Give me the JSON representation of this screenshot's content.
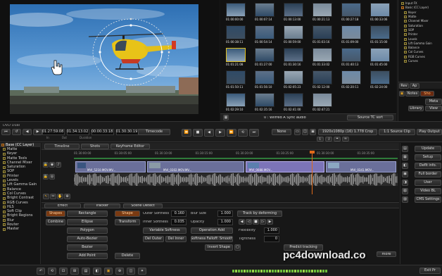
{
  "viewer": {
    "title": "DVD Dual"
  },
  "clip_grid": {
    "timecodes": [
      "01:00:00:00",
      "01:00:07:14",
      "01:00:13:00",
      "01:00:21:13",
      "01:00:27:18",
      "01:00:33:06",
      "01:00:38:11",
      "01:00:54:14",
      "01:00:59:00",
      "01:01:03:16",
      "01:01:09:00",
      "01:01:15:00",
      "01:01:21:08",
      "01:01:27:00",
      "01:01:30:16",
      "01:01:33:02",
      "01:01:40:13",
      "01:01:45:00",
      "01:01:50:11",
      "01:01:56:10",
      "01:02:05:23",
      "01:02:12:00",
      "01:02:20:11",
      "01:02:24:00",
      "01:02:29:10",
      "01:02:35:16",
      "01:02:41:00",
      "01:02:47:21",
      "01:02:55:07",
      "01:03:00:21",
      "01:03:05:06",
      "01:03:09:00"
    ],
    "footer_label": "0 : Wilfred A Sync audio",
    "source_sort": "Source TC sort"
  },
  "right_top": {
    "tree_items": [
      "Input FX",
      "Basic (CC Layer)",
      "Keyer",
      "Matte",
      "Channel Mixer",
      "Saturation",
      "SOP",
      "Printer",
      "Levels",
      "Lift Gamma Gain",
      "Balance",
      "Col Curves",
      "RGB Curves",
      "Curves"
    ],
    "tabs": [
      "Rev",
      "Ap"
    ],
    "mini_buttons": [
      "Notes",
      "Sho",
      "Meta"
    ],
    "library": "Library",
    "view": "View"
  },
  "toolbar": {
    "timecodes": [
      "01:27:59:08",
      "01:34:13:02",
      "00:00:33:18",
      "01:30:30:19"
    ],
    "sub_labels": [
      "In",
      "Out",
      "Duration",
      ""
    ],
    "timecode_label": "Timecode",
    "none": "None",
    "resolution": "1920x1080p (16) 1.778 Crop",
    "source_clip": "1:1 Source Clip",
    "play_output": "Play Output"
  },
  "left_tree": {
    "header": "Base (CC Layer)",
    "items": [
      "Matte",
      "Keyer",
      "Matte Tools",
      "Channel Mixer",
      "Saturation",
      "SOP",
      "Printer",
      "Levels",
      "Lift Gamma Gain",
      "Balance",
      "Col Curves",
      "Bright Contrast",
      "RGB Curves",
      "HLS",
      "Soft Clip",
      "Bright Regions",
      "Blur",
      "Router",
      "Master"
    ]
  },
  "timeline": {
    "tabs": [
      "Timeline",
      "Shots",
      "Keyframe Editor"
    ],
    "ruler": [
      "01:30:00:00",
      "01:30:05:00",
      "01:30:10:00",
      "01:30:15:00",
      "01:30:20:00",
      "01:30:25:00",
      "01:30:30:00",
      "01:30:35:00"
    ],
    "clips": [
      "MVI_5210.MOV.MV...",
      "MVI_0302.MOV.MV...",
      "MVI_0088.MOV...",
      "MVI_0341.MOV..."
    ],
    "fx_tabs": [
      "Effect",
      "Tracker",
      "Scene Detect"
    ]
  },
  "controls": {
    "left_buttons": [
      "Shapes",
      "Combine"
    ],
    "shape_buttons": [
      "Rectangle",
      "Ellipse",
      "Polygon",
      "Auto-Bezier",
      "Bezier",
      "Add Point"
    ],
    "shape_tab": "Shape",
    "transform": "Transform",
    "delete": "Delete",
    "outer_softness": "Outer Softness",
    "outer_softness_val": "0.160",
    "inner_softness": "Inner Softness",
    "inner_softness_val": "0.035",
    "variable_softness": "Variable Softness",
    "del_outer": "Del Outer",
    "del_inner": "Del Inner",
    "blur_size": "Blur Size",
    "blur_size_val": "1.000",
    "opacity": "Opacity",
    "opacity_val": "1.000",
    "operation_add": "Operation Add",
    "softness_falloff": "Softness Falloff: Smooth",
    "invert_shape": "Invert Shape",
    "track_by_deforming": "Track by deforming",
    "flexibility": "Flexibility",
    "flexibility_val": "1.000",
    "tightness": "Tightness",
    "tightness_val": "0",
    "predict_tracking": "Predict tracking",
    "more": "more"
  },
  "right_panel": {
    "items": [
      "Update",
      "Setup",
      "Deflt info.",
      "Full border",
      "User",
      "Video BL",
      "CMS Settings"
    ],
    "user_label": "User"
  },
  "watermark": "pc4download.co",
  "bottom": {
    "exit": "Exit Pr"
  }
}
